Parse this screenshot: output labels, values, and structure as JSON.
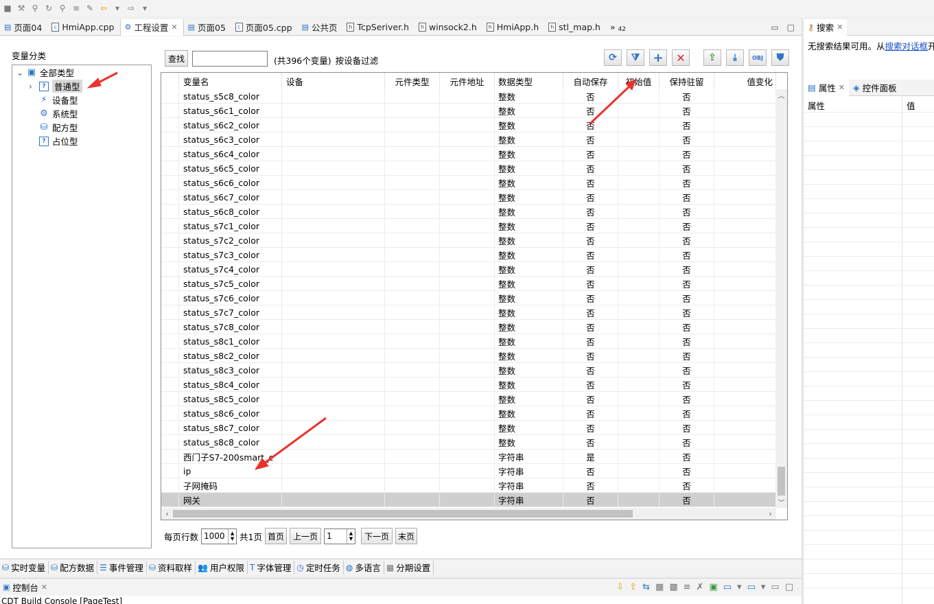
{
  "tabs": [
    {
      "icon": "page-icon",
      "label": "页面04"
    },
    {
      "icon": "cpp-file-icon",
      "label": "HmiApp.cpp"
    },
    {
      "icon": "gear-icon",
      "label": "工程设置",
      "active": true,
      "closable": true
    },
    {
      "icon": "page-icon",
      "label": "页面05"
    },
    {
      "icon": "cpp-file-icon",
      "label": "页面05.cpp"
    },
    {
      "icon": "page-icon",
      "label": "公共页"
    },
    {
      "icon": "header-file-icon",
      "label": "TcpSeriver.h"
    },
    {
      "icon": "header-file-icon",
      "label": "winsock2.h"
    },
    {
      "icon": "header-file-icon",
      "label": "HmiApp.h"
    },
    {
      "icon": "header-file-icon",
      "label": "stl_map.h"
    }
  ],
  "tab_overflow": {
    "symbol": "»",
    "count": "42"
  },
  "left": {
    "category_label": "变量分类",
    "tree": [
      {
        "label": "全部类型",
        "icon": "all-types-icon",
        "level": 0,
        "expanded": true
      },
      {
        "label": "普通型",
        "icon": "question-icon",
        "level": 1,
        "selected": true,
        "collapsed": true
      },
      {
        "label": "设备型",
        "icon": "plug-icon",
        "level": 1
      },
      {
        "label": "系统型",
        "icon": "gear-icon",
        "level": 1
      },
      {
        "label": "配方型",
        "icon": "database-icon",
        "level": 1
      },
      {
        "label": "占位型",
        "icon": "question-icon",
        "level": 1
      }
    ]
  },
  "search": {
    "button_label": "查找",
    "value": "",
    "count_text": "(共396个变量)",
    "filter_text": "按设备过滤"
  },
  "toolbar_icons": [
    "refresh-icon",
    "filter-add-icon",
    "add-icon",
    "delete-icon",
    "import-icon",
    "download-icon",
    "export-obj-icon",
    "shield-icon"
  ],
  "table": {
    "columns": [
      "",
      "变量名",
      "设备",
      "元件类型",
      "元件地址",
      "数据类型",
      "自动保存",
      "初始值",
      "保持驻留",
      "值变化"
    ],
    "rows": [
      {
        "name": "status_s5c8_color",
        "type": "整数",
        "autosave": "否",
        "retain": "否"
      },
      {
        "name": "status_s6c1_color",
        "type": "整数",
        "autosave": "否",
        "retain": "否"
      },
      {
        "name": "status_s6c2_color",
        "type": "整数",
        "autosave": "否",
        "retain": "否"
      },
      {
        "name": "status_s6c3_color",
        "type": "整数",
        "autosave": "否",
        "retain": "否"
      },
      {
        "name": "status_s6c4_color",
        "type": "整数",
        "autosave": "否",
        "retain": "否"
      },
      {
        "name": "status_s6c5_color",
        "type": "整数",
        "autosave": "否",
        "retain": "否"
      },
      {
        "name": "status_s6c6_color",
        "type": "整数",
        "autosave": "否",
        "retain": "否"
      },
      {
        "name": "status_s6c7_color",
        "type": "整数",
        "autosave": "否",
        "retain": "否"
      },
      {
        "name": "status_s6c8_color",
        "type": "整数",
        "autosave": "否",
        "retain": "否"
      },
      {
        "name": "status_s7c1_color",
        "type": "整数",
        "autosave": "否",
        "retain": "否"
      },
      {
        "name": "status_s7c2_color",
        "type": "整数",
        "autosave": "否",
        "retain": "否"
      },
      {
        "name": "status_s7c3_color",
        "type": "整数",
        "autosave": "否",
        "retain": "否"
      },
      {
        "name": "status_s7c4_color",
        "type": "整数",
        "autosave": "否",
        "retain": "否"
      },
      {
        "name": "status_s7c5_color",
        "type": "整数",
        "autosave": "否",
        "retain": "否"
      },
      {
        "name": "status_s7c6_color",
        "type": "整数",
        "autosave": "否",
        "retain": "否"
      },
      {
        "name": "status_s7c7_color",
        "type": "整数",
        "autosave": "否",
        "retain": "否"
      },
      {
        "name": "status_s7c8_color",
        "type": "整数",
        "autosave": "否",
        "retain": "否"
      },
      {
        "name": "status_s8c1_color",
        "type": "整数",
        "autosave": "否",
        "retain": "否"
      },
      {
        "name": "status_s8c2_color",
        "type": "整数",
        "autosave": "否",
        "retain": "否"
      },
      {
        "name": "status_s8c3_color",
        "type": "整数",
        "autosave": "否",
        "retain": "否"
      },
      {
        "name": "status_s8c4_color",
        "type": "整数",
        "autosave": "否",
        "retain": "否"
      },
      {
        "name": "status_s8c5_color",
        "type": "整数",
        "autosave": "否",
        "retain": "否"
      },
      {
        "name": "status_s8c6_color",
        "type": "整数",
        "autosave": "否",
        "retain": "否"
      },
      {
        "name": "status_s8c7_color",
        "type": "整数",
        "autosave": "否",
        "retain": "否"
      },
      {
        "name": "status_s8c8_color",
        "type": "整数",
        "autosave": "否",
        "retain": "否"
      },
      {
        "name": "西门子S7-200smart_c",
        "type": "字符串",
        "autosave": "是",
        "retain": "否"
      },
      {
        "name": "ip",
        "type": "字符串",
        "autosave": "否",
        "retain": "否"
      },
      {
        "name": "子网掩码",
        "type": "字符串",
        "autosave": "否",
        "retain": "否"
      },
      {
        "name": "网关",
        "type": "字符串",
        "autosave": "否",
        "retain": "否",
        "selected": true
      }
    ]
  },
  "pager": {
    "rows_per_page_label": "每页行数",
    "rows_per_page": "1000",
    "total_pages": "共1页",
    "first": "首页",
    "prev": "上一页",
    "page": "1",
    "next": "下一页",
    "last": "末页"
  },
  "bottom_tabs": [
    {
      "icon": "database-icon",
      "label": "实时变量"
    },
    {
      "icon": "database-icon",
      "label": "配方数据"
    },
    {
      "icon": "event-icon",
      "label": "事件管理"
    },
    {
      "icon": "database-icon",
      "label": "资料取样"
    },
    {
      "icon": "users-icon",
      "label": "用户权限"
    },
    {
      "icon": "font-icon",
      "label": "字体管理"
    },
    {
      "icon": "clock-icon",
      "label": "定时任务"
    },
    {
      "icon": "globe-icon",
      "label": "多语言"
    },
    {
      "icon": "grid-icon",
      "label": "分期设置"
    }
  ],
  "console": {
    "tab_label": "控制台",
    "text": "CDT Build Console [PageTest]"
  },
  "right": {
    "search_tab": "搜索",
    "search_message": "无搜索结果可用。从",
    "search_link": "搜索对话框",
    "search_tail": "开始",
    "props_tab": "属性",
    "widget_tab": "控件面板",
    "prop_col": "属性",
    "value_col": "值"
  },
  "colors": {
    "accent": "#2b74c7",
    "annotation_arrow": "#e8322b",
    "delete_red": "#d42a2a",
    "selected_row": "#cfcfcf"
  }
}
